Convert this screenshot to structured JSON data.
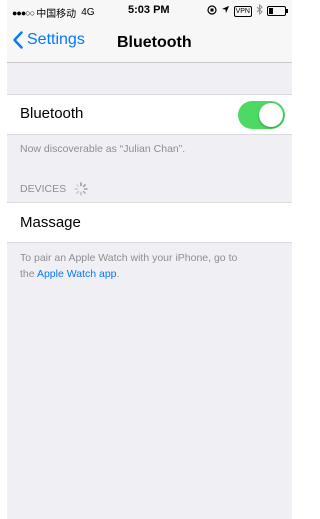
{
  "status_bar": {
    "carrier": "中国移动",
    "network": "4G",
    "time": "5:03 PM",
    "vpn_label": "VPN"
  },
  "nav": {
    "back_label": "Settings",
    "title": "Bluetooth"
  },
  "bluetooth": {
    "label": "Bluetooth",
    "enabled": true,
    "discoverable_text": "Now discoverable as “Julian Chan”."
  },
  "devices": {
    "header": "DEVICES",
    "items": [
      {
        "label": "Massage"
      }
    ]
  },
  "footer": {
    "text_line1": "To pair an Apple Watch with your iPhone, go to",
    "text_prefix": "the ",
    "link_label": "Apple Watch app",
    "text_suffix": "."
  },
  "colors": {
    "accent": "#007aff",
    "toggle_on": "#4cd964",
    "background": "#efeff4",
    "secondary_text": "#8e8e93"
  }
}
